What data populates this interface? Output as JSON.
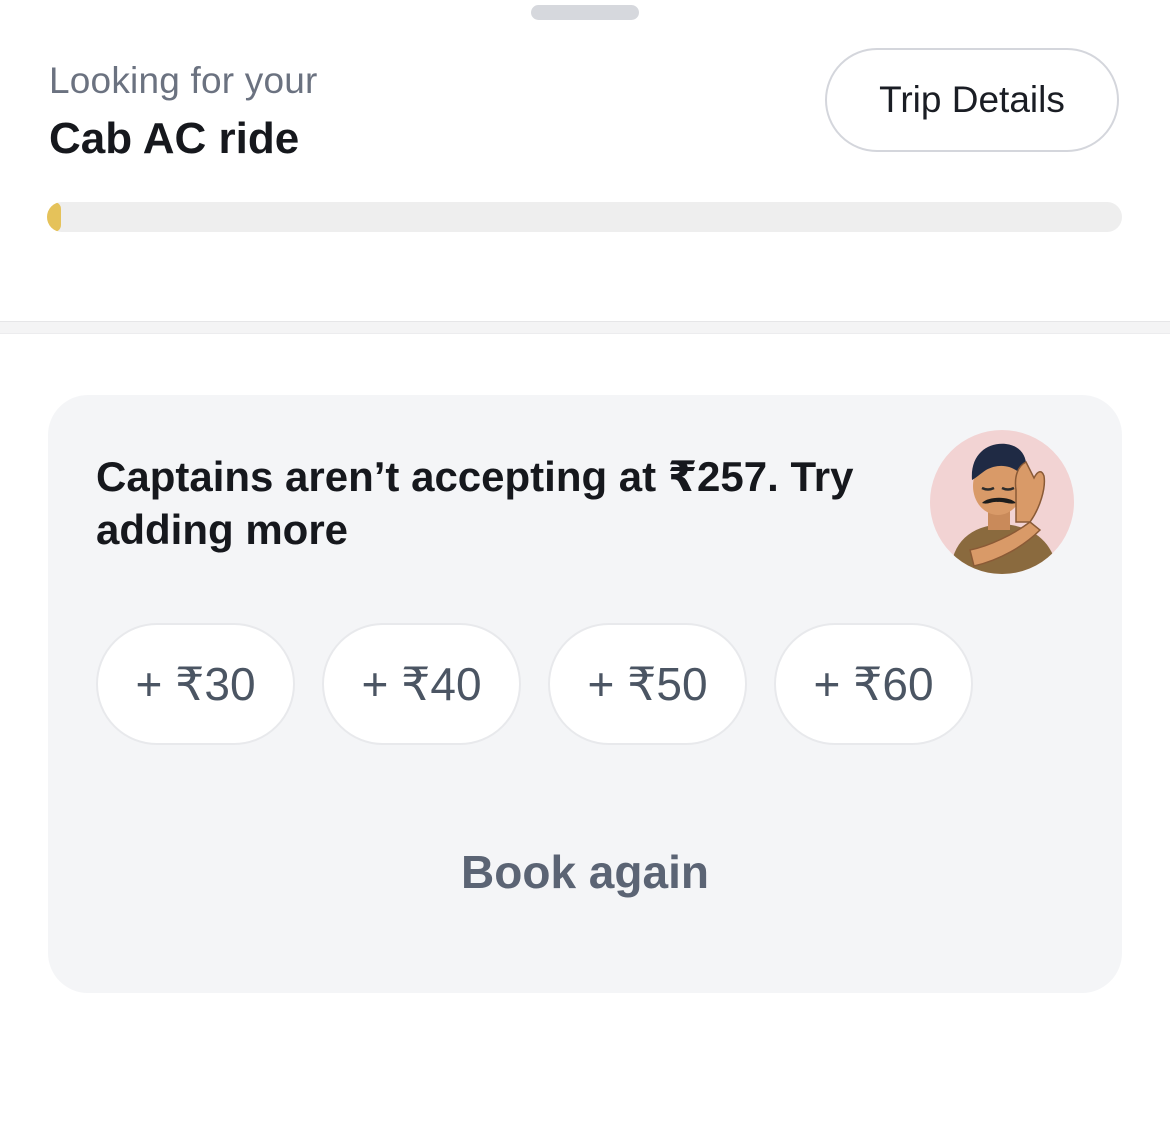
{
  "header": {
    "subtitle": "Looking for your",
    "ride_type": "Cab AC ride",
    "trip_details_label": "Trip Details"
  },
  "search_progress": {
    "percent": 1,
    "color": "#e5c25a"
  },
  "offer_card": {
    "message": "Captains aren’t accepting at ₹257. Try adding more",
    "illustration_icon": "captain-declining-illustration",
    "tip_options": [
      "+ ₹30",
      "+ ₹40",
      "+ ₹50",
      "+ ₹60"
    ],
    "book_again_label": "Book again"
  }
}
